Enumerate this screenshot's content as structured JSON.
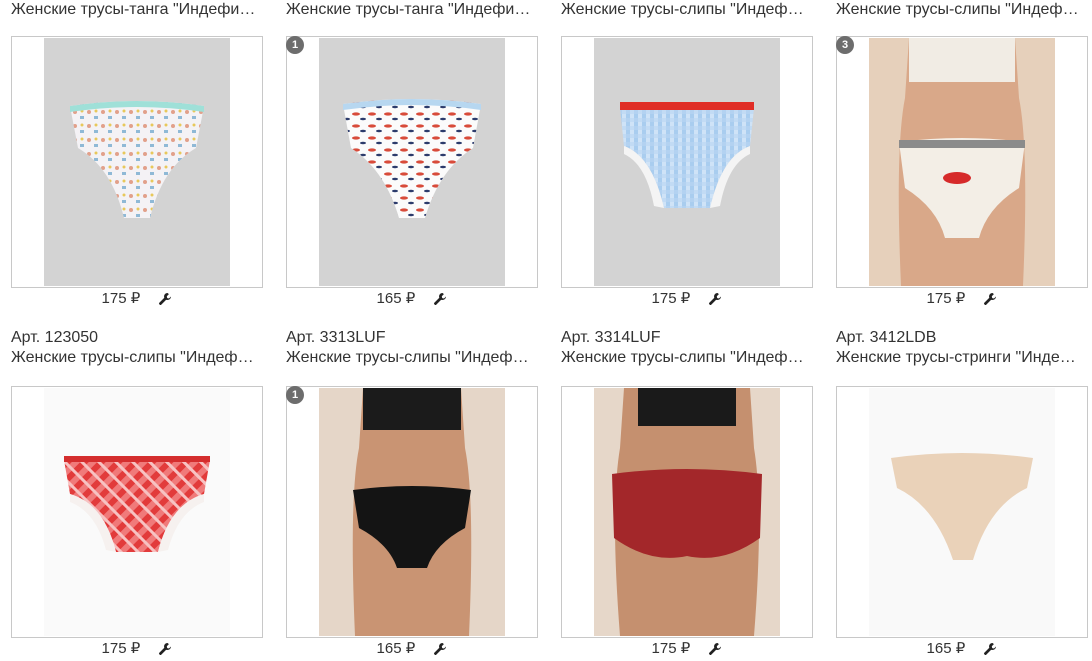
{
  "currency": "₽",
  "products": [
    {
      "article": "",
      "name": "Женские трусы-танга \"Индефини\" (Арт. ...)",
      "price": "175 ₽",
      "badge": "",
      "icon": "product-photo"
    },
    {
      "article": "",
      "name": "Женские трусы-танга \"Индефини\" (Арт. ...)",
      "price": "165 ₽",
      "badge": "1",
      "icon": "product-photo"
    },
    {
      "article": "",
      "name": "Женские трусы-слипы \"Индефини\" (Арт. ...)",
      "price": "175 ₽",
      "badge": "",
      "icon": "product-photo"
    },
    {
      "article": "",
      "name": "Женские трусы-слипы \"Индефини\" (Арт. ...)",
      "price": "175 ₽",
      "badge": "3",
      "icon": "product-photo"
    },
    {
      "article": "Арт. 123050",
      "name": "Женские трусы-слипы \"Индефини\" (Арт. ...)",
      "price": "175 ₽",
      "badge": "",
      "icon": "product-photo"
    },
    {
      "article": "Арт. 3313LUF",
      "name": "Женские трусы-слипы \"Индефини\" (Арт. ...)",
      "price": "165 ₽",
      "badge": "1",
      "icon": "product-photo"
    },
    {
      "article": "Арт. 3314LUF",
      "name": "Женские трусы-слипы \"Индефини\" (Арт. ...)",
      "price": "175 ₽",
      "badge": "",
      "icon": "product-photo"
    },
    {
      "article": "Арт. 3412LDB",
      "name": "Женские трусы-стринги \"Индефини\" (Арт. ...)",
      "price": "165 ₽",
      "badge": "",
      "icon": "product-photo"
    }
  ],
  "icons": {
    "settings": "wrench-icon"
  },
  "colors": {
    "text": "#333333",
    "border": "#c8c8c8",
    "badge": "#6d6d6d",
    "placeholder_bg": "#d3d3d3"
  }
}
